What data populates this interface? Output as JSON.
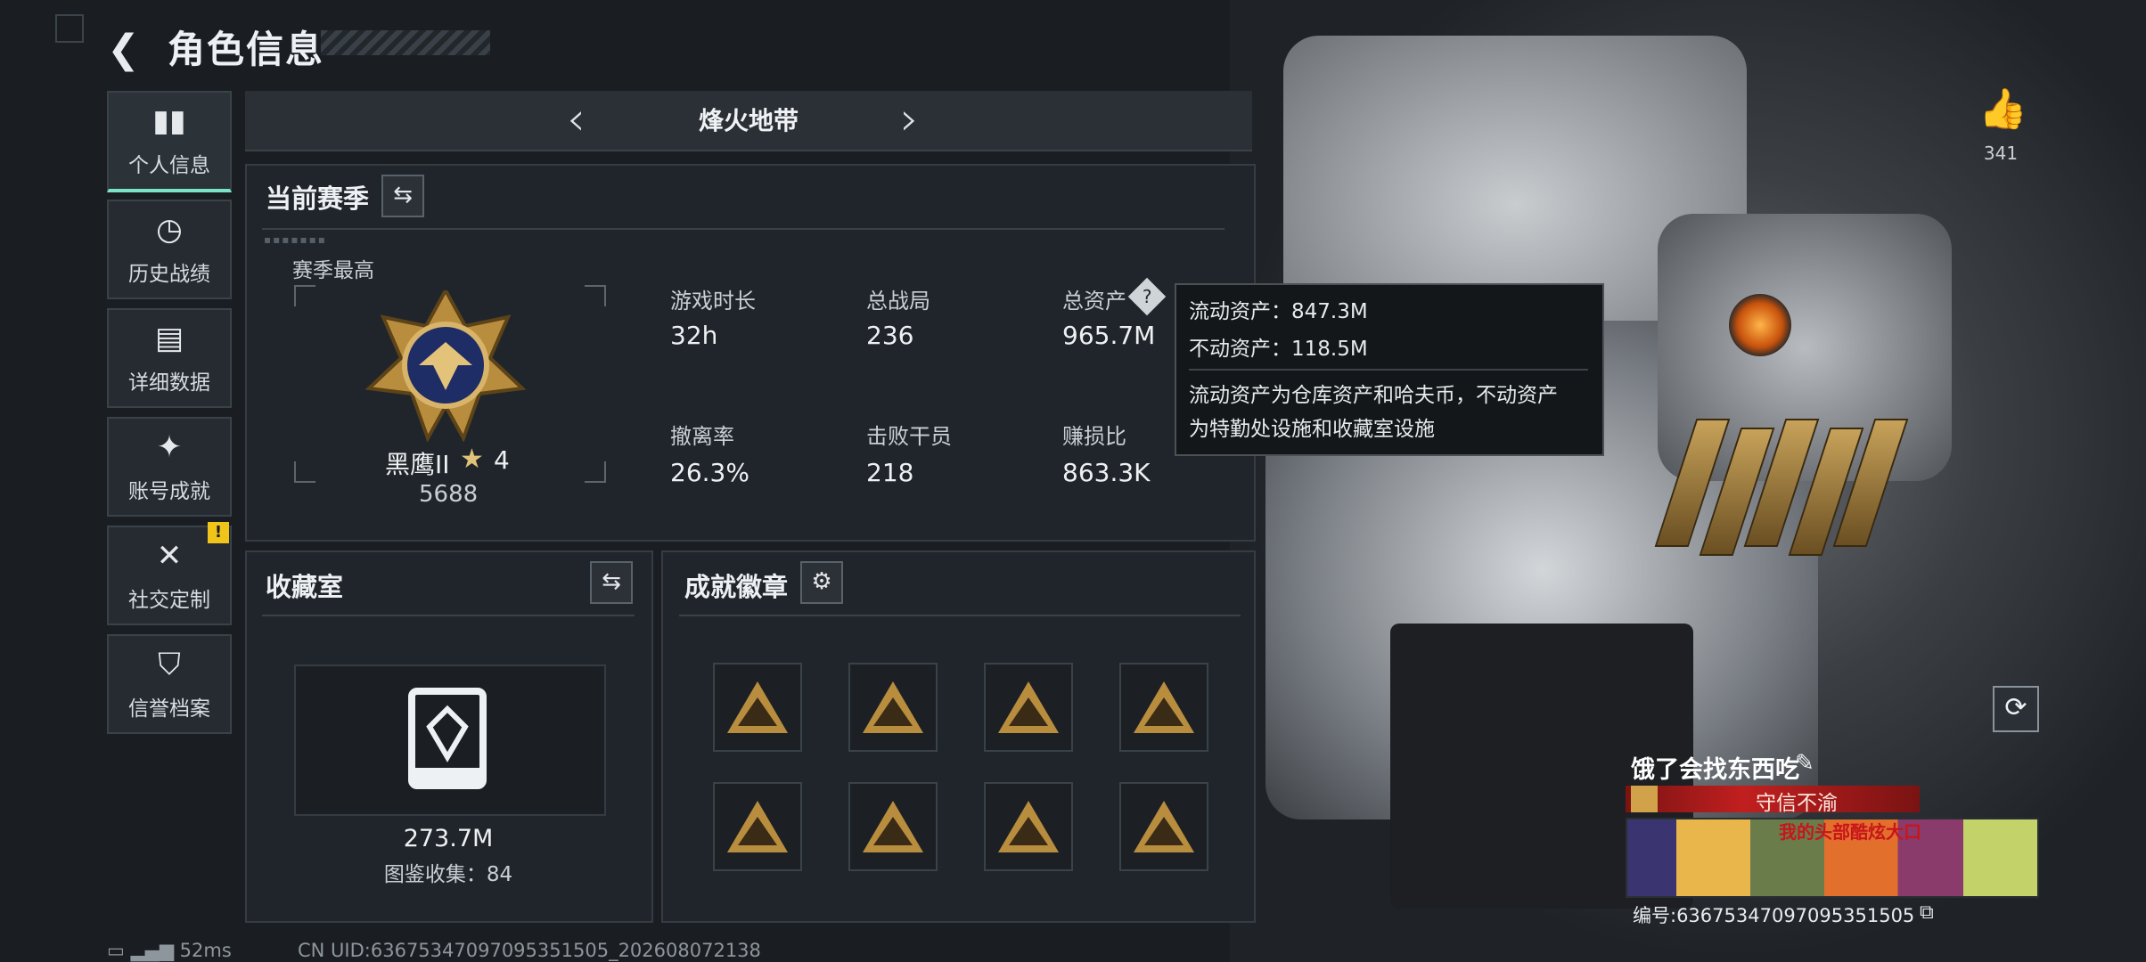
{
  "header": {
    "title": "角色信息"
  },
  "sidebar": {
    "items": [
      {
        "label": "个人信息",
        "active": true,
        "icon": "bar-chart-icon"
      },
      {
        "label": "历史战绩",
        "active": false,
        "icon": "clock-icon"
      },
      {
        "label": "详细数据",
        "active": false,
        "icon": "folder-icon"
      },
      {
        "label": "账号成就",
        "active": false,
        "icon": "achievement-icon"
      },
      {
        "label": "社交定制",
        "active": false,
        "icon": "tools-icon",
        "alert": "!"
      },
      {
        "label": "信誉档案",
        "active": false,
        "icon": "shield-icon"
      }
    ]
  },
  "mode_nav": {
    "title": "烽火地带"
  },
  "season": {
    "title": "当前赛季",
    "highest_label": "赛季最高",
    "rank_name": "黑鹰II",
    "rank_stars": "4",
    "rank_points": "5688",
    "stats": [
      {
        "label": "游戏时长",
        "value": "32h"
      },
      {
        "label": "总战局",
        "value": "236"
      },
      {
        "label": "总资产",
        "value": "965.7M"
      },
      {
        "label": "撤离率",
        "value": "26.3%"
      },
      {
        "label": "击败干员",
        "value": "218"
      },
      {
        "label": "赚损比",
        "value": "863.3K"
      }
    ]
  },
  "tooltip": {
    "liquid": "流动资产：847.3M",
    "fixed": "不动资产：118.5M",
    "desc_line1": "流动资产为仓库资产和哈夫币，不动资产",
    "desc_line2": "为特勤处设施和收藏室设施"
  },
  "collection": {
    "title": "收藏室",
    "value": "273.7M",
    "codex_label": "图鉴收集：84"
  },
  "achievements": {
    "title": "成就徽章",
    "badges": [
      "badge-1",
      "badge-2",
      "badge-3",
      "badge-4",
      "badge-5",
      "badge-6",
      "badge-7",
      "badge-8"
    ]
  },
  "profile": {
    "likes": "341",
    "player_name": "饿了会找东西吃",
    "motto": "守信不渝",
    "banner_text": "我的头部酷炫大口",
    "player_id": "编号:636753470970953515​05"
  },
  "footer": {
    "ping": "52ms",
    "uid": "CN UID:6367534709709535150​5_202608072138"
  },
  "colors": {
    "accent": "#7be3c6",
    "alert": "#f0c419",
    "gold": "#b98d3e",
    "motto_red": "#c11f1f"
  }
}
